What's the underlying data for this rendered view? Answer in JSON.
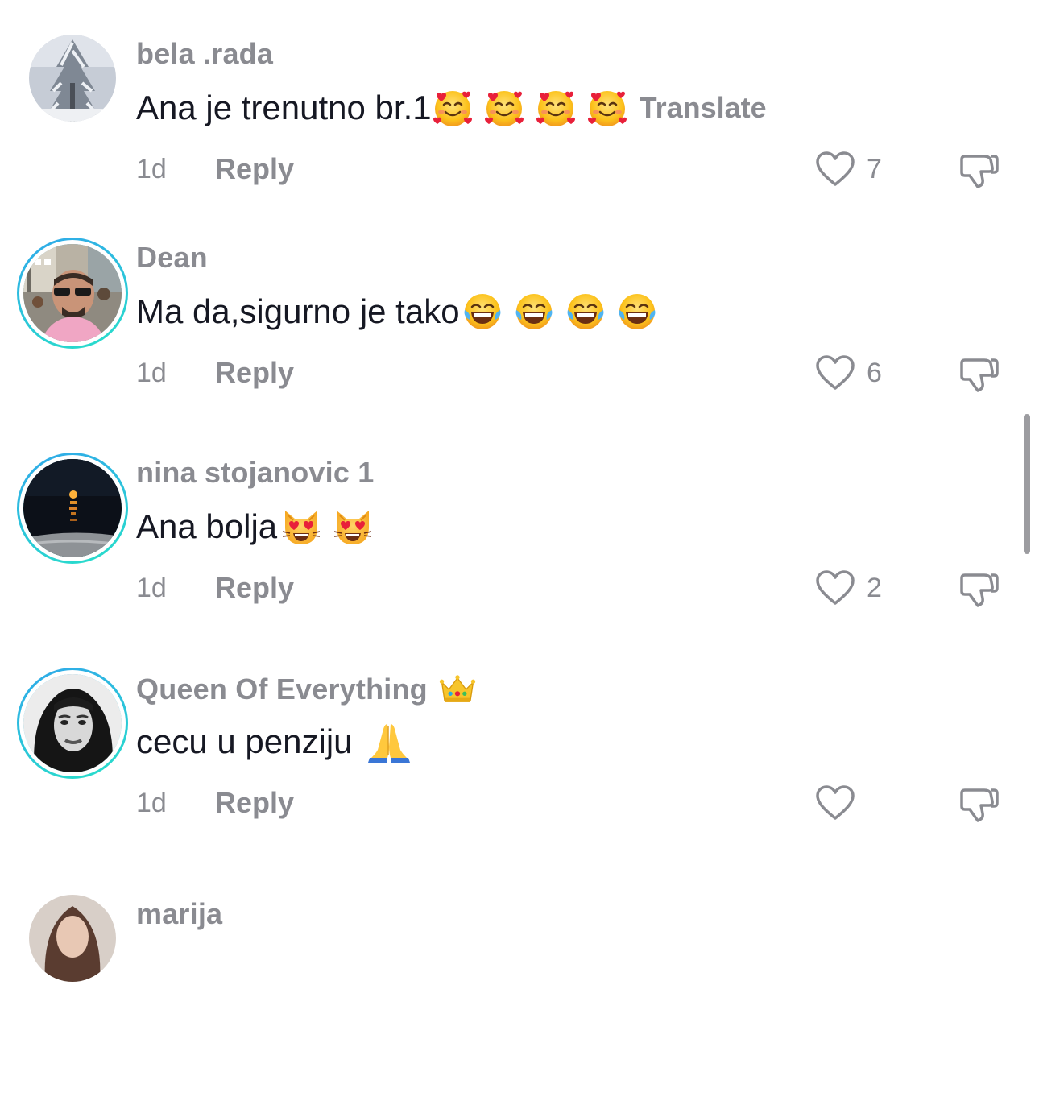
{
  "comments": [
    {
      "username": "bela .rada",
      "text": "Ana je trenutno br.1",
      "emojis": [
        "smiling-face-with-hearts",
        "smiling-face-with-hearts",
        "smiling-face-with-hearts",
        "smiling-face-with-hearts"
      ],
      "translate_label": "Translate",
      "time": "1d",
      "reply_label": "Reply",
      "likes": "7",
      "avatar_ring": false,
      "avatar": "snowy-tree"
    },
    {
      "username": "Dean",
      "text": "Ma da,sigurno je tako",
      "emojis": [
        "tears-of-joy",
        "tears-of-joy",
        "tears-of-joy",
        "tears-of-joy"
      ],
      "time": "1d",
      "reply_label": "Reply",
      "likes": "6",
      "avatar_ring": true,
      "avatar": "man-sunglasses"
    },
    {
      "username": "nina stojanovic 1",
      "text": "Ana bolja",
      "emojis": [
        "heart-eyes-cat",
        "heart-eyes-cat"
      ],
      "time": "1d",
      "reply_label": "Reply",
      "likes": "2",
      "avatar_ring": true,
      "avatar": "night-sea"
    },
    {
      "username": "Queen Of Everything",
      "username_emoji": "crown",
      "text": "cecu u penziju ",
      "emojis": [
        "folded-hands"
      ],
      "time": "1d",
      "reply_label": "Reply",
      "likes": "",
      "avatar_ring": true,
      "avatar": "woman-portrait"
    },
    {
      "username": "marija",
      "avatar_ring": false,
      "avatar": "woman-brown-hair"
    }
  ],
  "colors": {
    "ring_start": "#30a8ea",
    "ring_end": "#28e0c9",
    "secondary_text": "#8a8b91",
    "primary_text": "#161823"
  }
}
